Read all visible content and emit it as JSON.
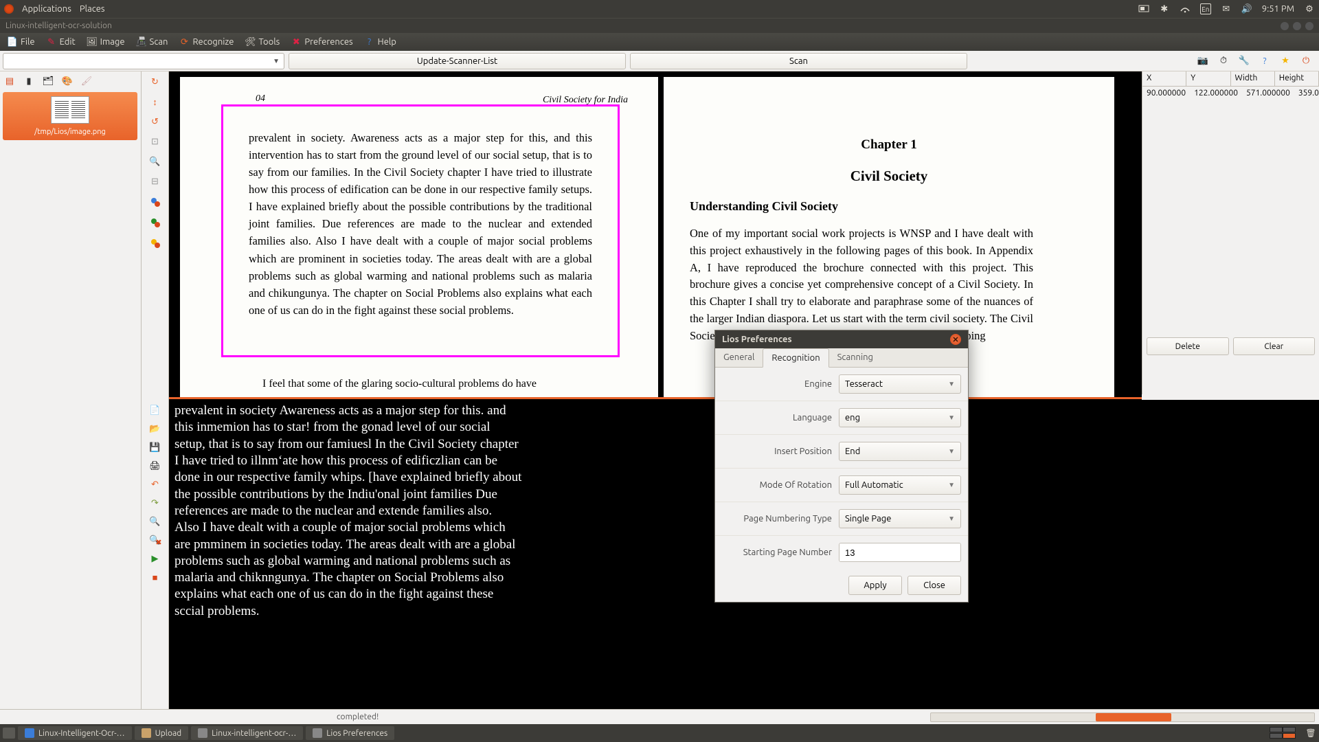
{
  "panel": {
    "applications": "Applications",
    "places": "Places",
    "lang": "En",
    "time": "9:51 PM"
  },
  "window": {
    "title": "Linux-intelligent-ocr-solution"
  },
  "menu": {
    "file": "File",
    "edit": "Edit",
    "image": "Image",
    "scan": "Scan",
    "recognize": "Recognize",
    "tools": "Tools",
    "preferences": "Preferences",
    "help": "Help"
  },
  "toolbar": {
    "update_scanner": "Update-Scanner-List",
    "scan": "Scan"
  },
  "thumbnail": {
    "path": "/tmp/Lios/image.png"
  },
  "coords": {
    "headers": {
      "x": "X",
      "y": "Y",
      "w": "Width",
      "h": "Height"
    },
    "values": {
      "x": "90.000000",
      "y": "122.000000",
      "w": "571.000000",
      "h": "359.000000"
    }
  },
  "right_buttons": {
    "delete": "Delete",
    "clear": "Clear"
  },
  "status": {
    "text": "completed!"
  },
  "taskbar": {
    "t1": "Linux-Intelligent-Ocr-…",
    "t2": "Upload",
    "t3": "Linux-intelligent-ocr-…",
    "t4": "Lios Preferences"
  },
  "page_left": {
    "num": "04",
    "hdr": "Civil Society for India",
    "body": "prevalent in society. Awareness acts as a major step for this, and this intervention has to start from the ground level of our social setup, that is to say from our families. In the Civil Society chapter I have tried to illustrate how this process of edification can be done in our respective family setups. I have explained briefly about the possible contributions by the traditional joint families. Due references are made to the nuclear and extended families also. Also I have dealt with a couple of major social problems which are prominent in societies today. The areas dealt with are a global problems such as global warming and national problems such as malaria and chikungunya. The chapter on Social Problems also explains what each one of us can do in the fight against these social problems.",
    "feel": "I feel that some of the glaring socio-cultural problems do have"
  },
  "page_right": {
    "chapter": "Chapter 1",
    "title": "Civil Society",
    "heading": "Understanding Civil Society",
    "body": "One of my important social work projects is WNSP and I have dealt with this project exhaustively in the following pages of this book.  In Appendix A, I have reproduced the brochure connected with this project. This brochure gives a concise yet comprehensive concept of a Civil Society.  In this Chapter I shall try to elaborate and paraphrase some of the nuances of the larger Indian diaspora.\n       Let us start with the term civil society. The Civil Society can be defined as the aggregate of the rapidly developing"
  },
  "ocr_text": "prevalent in society Awareness acts as a major step for this. and\nthis inmemion has to star! from the gonad level of our social\nsetup, that is to say from our famiuesl In the Civil Society chapter\nI have tried to illnm‘ate how this process of edificzlian can be\ndone in our respective family whips. [have explained briefly about\nthe possible contributions by the Indiu'onal joint families Due\nreferences are made to the nuclear and extende families also.\nAlso I have dealt with a couple of major social problems which\nare pmminem in societies today. The areas dealt with are a global\nproblems such as global warming and national problems such as\nmalaria and chiknngunya. The chapter on Social Problems also\nexplains what each one of us can do in the fight against these\nsccial problems.",
  "dialog": {
    "title": "Lios Preferences",
    "tabs": {
      "general": "General",
      "recognition": "Recognition",
      "scanning": "Scanning"
    },
    "labels": {
      "engine": "Engine",
      "language": "Language",
      "insert": "Insert Position",
      "rotation": "Mode Of Rotation",
      "pagenum_type": "Page Numbering Type",
      "start_page": "Starting Page Number"
    },
    "values": {
      "engine": "Tesseract",
      "language": "eng",
      "insert": "End",
      "rotation": "Full Automatic",
      "pagenum_type": "Single Page",
      "start_page": "13"
    },
    "buttons": {
      "apply": "Apply",
      "close": "Close"
    }
  }
}
